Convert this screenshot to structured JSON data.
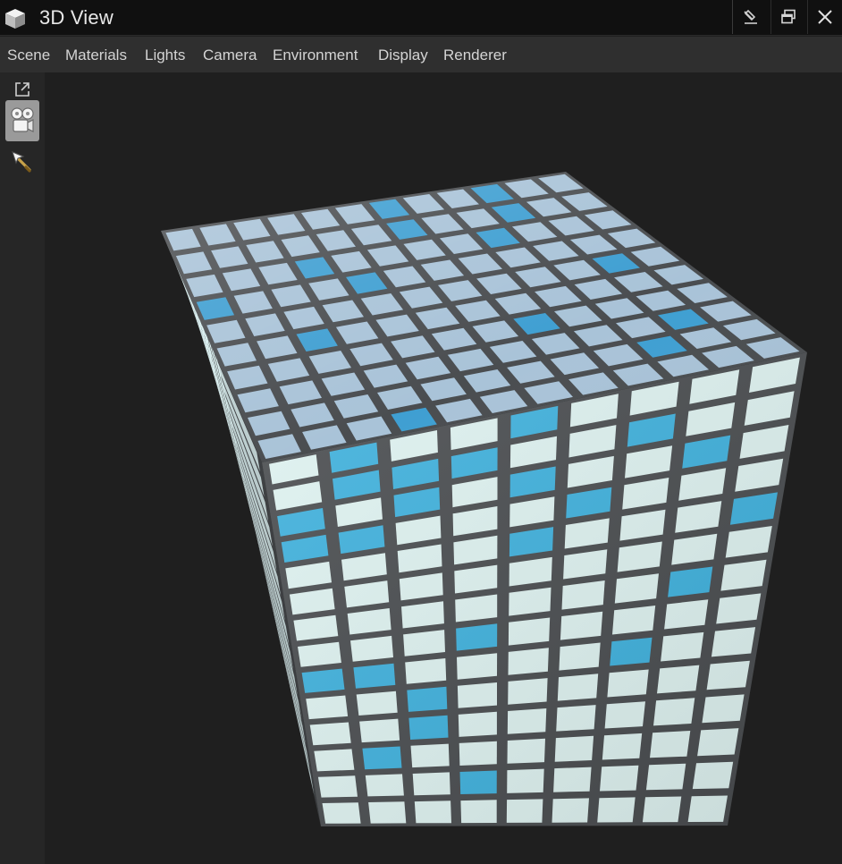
{
  "window": {
    "title": "3D View",
    "icon": "cube-icon",
    "controls": [
      "pin-icon",
      "restore-icon",
      "close-icon"
    ]
  },
  "menu": {
    "items": [
      {
        "label": "Scene"
      },
      {
        "label": "Materials"
      },
      {
        "label": "Lights"
      },
      {
        "label": "Camera"
      },
      {
        "label": "Environment"
      },
      {
        "label": "Display"
      },
      {
        "label": "Renderer"
      }
    ]
  },
  "toolbar": {
    "tools": [
      {
        "icon": "external-link-icon",
        "active": false
      },
      {
        "icon": "camera-icon",
        "active": true
      },
      {
        "icon": "pointer-icon",
        "active": false
      }
    ]
  },
  "scene": {
    "object": "tiled cube",
    "grout_color": "#4a4d50",
    "top_face": {
      "rows": 10,
      "cols": 12,
      "tile_color": "#a9c3d8",
      "accent_color": "#3f9fd2",
      "accents": [
        [
          0,
          6
        ],
        [
          0,
          9
        ],
        [
          1,
          6
        ],
        [
          1,
          9
        ],
        [
          2,
          3
        ],
        [
          2,
          8
        ],
        [
          3,
          0
        ],
        [
          3,
          4
        ],
        [
          4,
          10
        ],
        [
          5,
          2
        ],
        [
          6,
          7
        ],
        [
          7,
          10
        ],
        [
          8,
          9
        ],
        [
          9,
          3
        ]
      ]
    },
    "front_face": {
      "rows": 14,
      "cols": 9,
      "tile_color": "#dff3f1",
      "accent_color": "#40b2de",
      "accents": [
        [
          0,
          1
        ],
        [
          0,
          4
        ],
        [
          1,
          1
        ],
        [
          1,
          2
        ],
        [
          1,
          3
        ],
        [
          1,
          6
        ],
        [
          2,
          0
        ],
        [
          2,
          2
        ],
        [
          2,
          4
        ],
        [
          2,
          7
        ],
        [
          3,
          0
        ],
        [
          3,
          1
        ],
        [
          3,
          5
        ],
        [
          4,
          4
        ],
        [
          4,
          8
        ],
        [
          6,
          7
        ],
        [
          7,
          3
        ],
        [
          8,
          0
        ],
        [
          8,
          1
        ],
        [
          8,
          6
        ],
        [
          9,
          2
        ],
        [
          10,
          2
        ],
        [
          11,
          1
        ],
        [
          12,
          3
        ]
      ]
    },
    "side_face": {
      "rows": 14,
      "cols": 2,
      "tile_color": "#dbeff0",
      "accent_color": "#3fa8d8"
    }
  }
}
